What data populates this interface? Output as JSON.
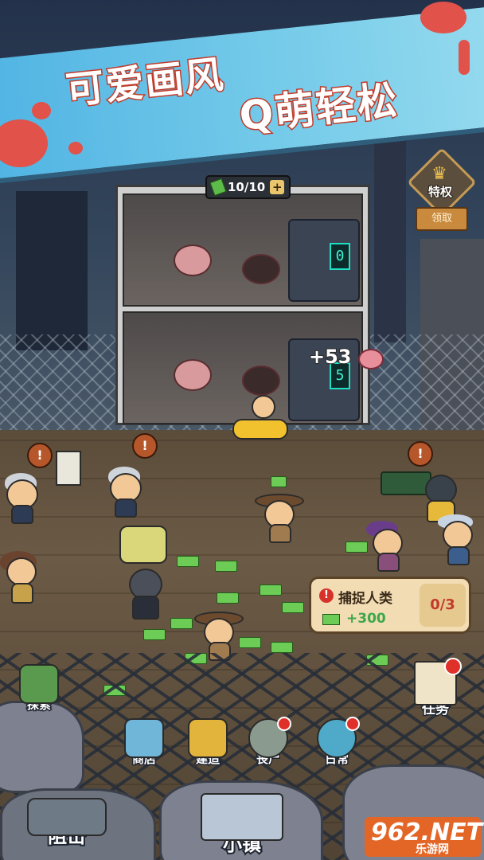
{
  "banner": {
    "line1": "可爱画风",
    "line2": "Q萌轻松"
  },
  "building": {
    "capacity": "10/10",
    "floor1_counter": "0",
    "floor2_counter": "5",
    "gain": "+53"
  },
  "privilege": {
    "label": "特权",
    "claim": "领取"
  },
  "quest": {
    "title": "捕捉人类",
    "reward": "+300",
    "progress": "0/3"
  },
  "nav": {
    "explore": "探索",
    "shop": "商店",
    "build": "建造",
    "zombie": "丧尸",
    "daily": "日常",
    "task": "任务",
    "block": "阻击",
    "town": "小镇"
  },
  "watermark": {
    "brand": "962.NET",
    "site": "乐游网"
  },
  "colors": {
    "banner": "#4fb3e3",
    "accent_text_stroke": "#c03c2a",
    "money": "#6ccc55",
    "alert": "#e0302a"
  }
}
